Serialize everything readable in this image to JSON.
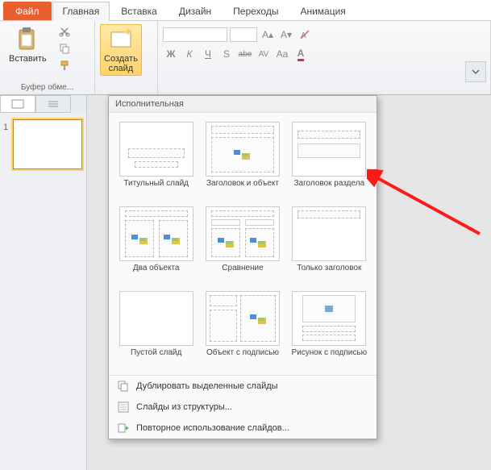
{
  "tabs": {
    "file": "Файл",
    "home": "Главная",
    "insert": "Вставка",
    "design": "Дизайн",
    "transitions": "Переходы",
    "animation": "Анимация"
  },
  "ribbon": {
    "clipboard_group": "Буфер обме...",
    "paste": "Вставить",
    "new_slide": "Создать\nслайд",
    "font_buttons": {
      "b": "Ж",
      "i": "К",
      "u": "Ч",
      "s": "S",
      "strike": "abe",
      "av": "AV",
      "aa": "Aa"
    }
  },
  "panel": {
    "slide_num": "1"
  },
  "gallery": {
    "header": "Исполнительная",
    "layouts": [
      "Титульный слайд",
      "Заголовок и объект",
      "Заголовок раздела",
      "Два объекта",
      "Сравнение",
      "Только заголовок",
      "Пустой слайд",
      "Объект с подписью",
      "Рисунок с подписью"
    ],
    "menu": {
      "duplicate": "Дублировать выделенные слайды",
      "outline": "Слайды из структуры...",
      "reuse": "Повторное использование слайдов..."
    }
  }
}
